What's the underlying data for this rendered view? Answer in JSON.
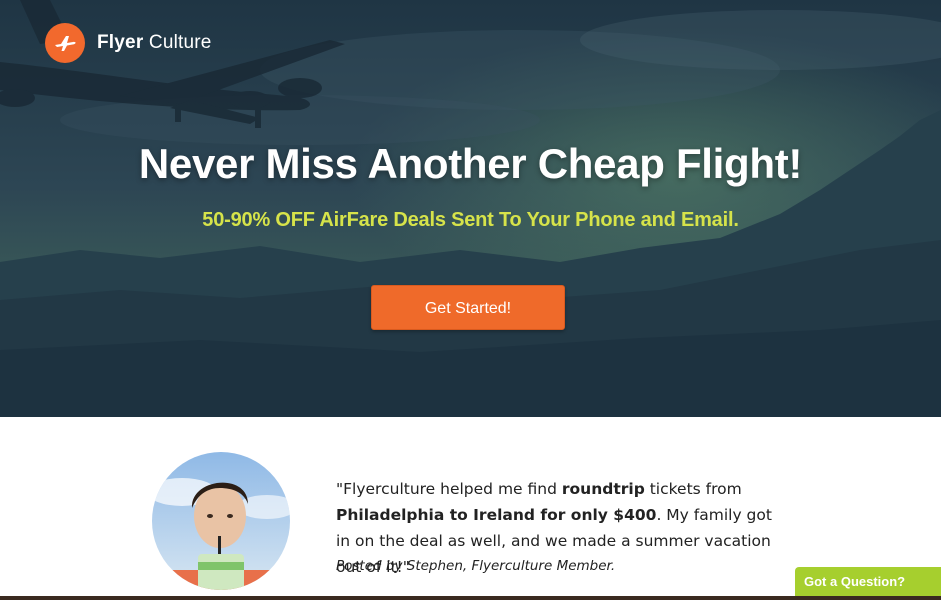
{
  "brand": {
    "name_bold": "Flyer",
    "name_regular": "Culture",
    "logo_icon": "airplane-icon",
    "accent_color": "#f2692d"
  },
  "hero": {
    "headline": "Never Miss Another Cheap Flight!",
    "subheadline": "50-90% OFF AirFare Deals Sent To Your Phone and Email.",
    "cta_label": "Get Started!",
    "subheadline_color": "#d6e34a",
    "cta_color": "#ef6a2a"
  },
  "testimonial": {
    "quote_open": "\"Flyerculture helped me find ",
    "quote_bold1": "roundtrip",
    "quote_mid": " tickets from ",
    "quote_bold2": "Philadelphia to Ireland for only $400",
    "quote_end": ". My family got in on the deal as well, and we made a summer vacation out of it!\"",
    "byline": "Posted by Stephen, Flyerculture Member."
  },
  "chat": {
    "label": "Got a Question?",
    "color": "#a6cf2e"
  }
}
